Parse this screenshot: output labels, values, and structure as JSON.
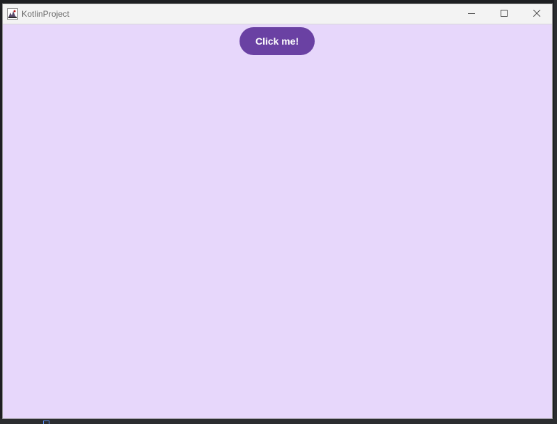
{
  "window": {
    "title": "KotlinProject"
  },
  "titlebar": {
    "icons": {
      "app": "app-icon",
      "minimize": "minimize-icon",
      "maximize": "maximize-icon",
      "close": "close-icon"
    }
  },
  "main": {
    "button_label": "Click me!"
  },
  "colors": {
    "window_background": "#e7d7fb",
    "button_background": "#6a41a3",
    "titlebar_background": "#f3f3f3",
    "title_text": "#6a6a6a"
  }
}
